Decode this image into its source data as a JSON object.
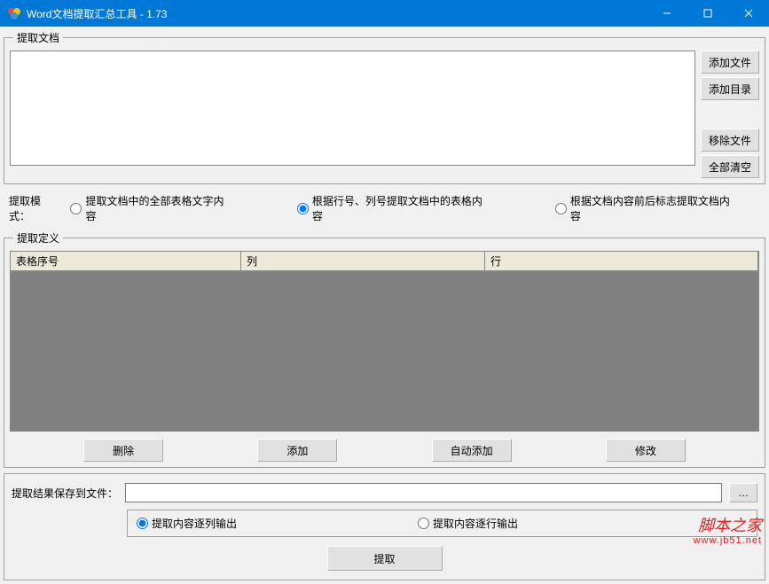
{
  "window": {
    "title": "Word文档提取汇总工具 - 1.73"
  },
  "panels": {
    "extract_docs": "提取文档",
    "extract_def": "提取定义"
  },
  "buttons": {
    "add_file": "添加文件",
    "add_dir": "添加目录",
    "remove_file": "移除文件",
    "clear_all": "全部清空",
    "delete": "删除",
    "add": "添加",
    "auto_add": "自动添加",
    "modify": "修改",
    "browse": "…",
    "extract": "提取"
  },
  "mode": {
    "label": "提取模式：",
    "opt_all": "提取文档中的全部表格文字内容",
    "opt_rowcol": "根据行号、列号提取文档中的表格内容",
    "opt_marker": "根据文档内容前后标志提取文档内容"
  },
  "grid": {
    "col1": "表格序号",
    "col2": "列",
    "col3": "行"
  },
  "output": {
    "label": "提取结果保存到文件：",
    "path": "",
    "opt_by_column": "提取内容逐列输出",
    "opt_by_row": "提取内容逐行输出"
  },
  "watermark": {
    "text": "脚本之家",
    "url": "www.jb51.net"
  }
}
